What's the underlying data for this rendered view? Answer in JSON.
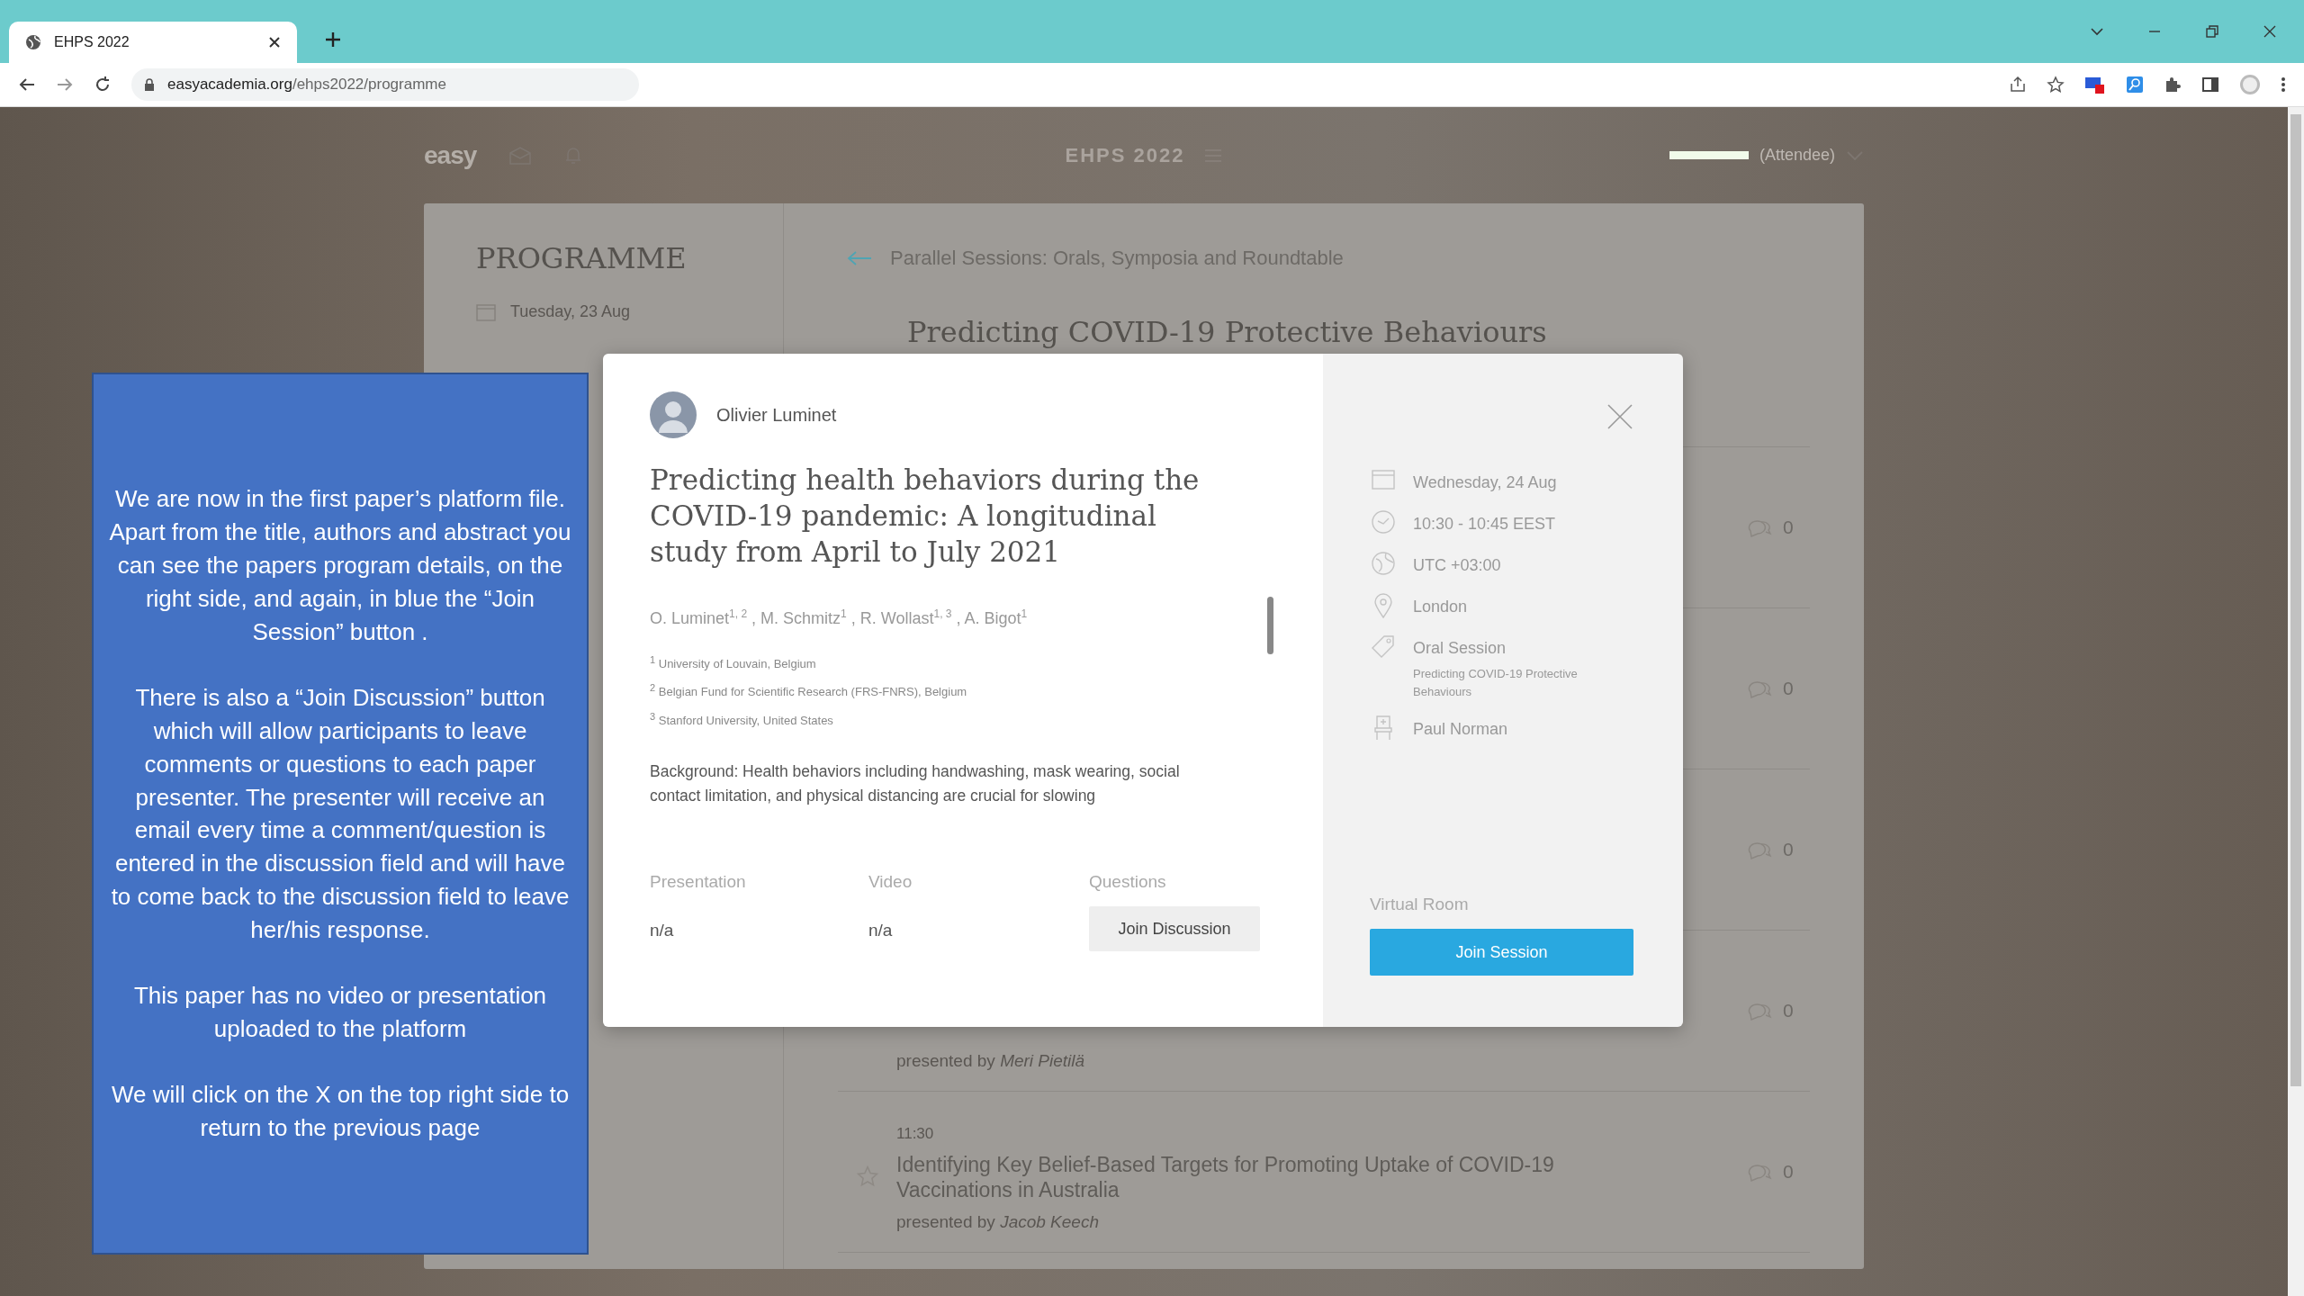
{
  "browser": {
    "tab": {
      "title": "EHPS 2022",
      "selected": true
    },
    "url_host": "easyacademia.org",
    "url_path": "/ehps2022/programme"
  },
  "header": {
    "logo": "easy",
    "event": "EHPS 2022",
    "role": "(Attendee)"
  },
  "programme": {
    "title": "PROGRAMME",
    "date": "Tuesday, 23 Aug"
  },
  "session": {
    "breadcrumb": "Parallel Sessions: Orals, Symposia and Roundtable",
    "title": "Predicting COVID-19 Protective Behaviours",
    "talks": [
      {
        "comments": "0"
      },
      {
        "comments": "0"
      },
      {
        "comments": "0"
      },
      {
        "presenter_prefix": "presented by",
        "presenter": "Meri Pietilä",
        "comments": "0"
      },
      {
        "time": "11:30",
        "starred": false,
        "title": "Identifying Key Belief-Based Targets for Promoting Uptake of COVID-19 Vaccinations in Australia",
        "presenter_prefix": "presented by",
        "presenter": "Jacob Keech",
        "comments": "0"
      }
    ]
  },
  "modal": {
    "presenter": "Olivier Luminet",
    "title": "Predicting health behaviors during the COVID-19 pandemic: A longitudinal study from April to July 2021",
    "authors": "O. Luminet$^{1, 2}$ , M. Schmitz$^{1}$ , R. Wollast$^{1, 3}$ , A. Bigot$^{1}$",
    "affiliations": [
      {
        "mark": "1",
        "text": "University of Louvain, Belgium"
      },
      {
        "mark": "2",
        "text": "Belgian Fund for Scientific Research (FRS-FNRS), Belgium"
      },
      {
        "mark": "3",
        "text": "Stanford University, United States"
      }
    ],
    "abstract": "Background: Health behaviors including handwashing, mask wearing, social contact limitation, and physical distancing are crucial for slowing",
    "footer": [
      {
        "label": "Presentation",
        "kind": "text",
        "value": "n/a"
      },
      {
        "label": "Video",
        "kind": "text",
        "value": "n/a"
      },
      {
        "label": "Questions",
        "kind": "button",
        "value": "Join Discussion"
      }
    ],
    "details": [
      {
        "kind": "date",
        "text": "Wednesday, 24 Aug"
      },
      {
        "kind": "time",
        "text": "10:30 - 10:45 EEST"
      },
      {
        "kind": "timezone",
        "text": "UTC +03:00"
      },
      {
        "kind": "location",
        "text": "London"
      },
      {
        "kind": "session",
        "text": "Oral Session",
        "detail": "Predicting COVID-19 Protective Behaviours"
      },
      {
        "kind": "chair",
        "text": "Paul Norman"
      }
    ],
    "room_label": "Virtual Room",
    "room_button": "Join Session"
  },
  "annotation": {
    "paragraphs": [
      "We are now in the first paper’s platform file. Apart from the title, authors and abstract you can see the papers program details, on the right side, and again, in blue the “Join Session” button .",
      "There is also a “Join Discussion” button which will allow participants to leave comments or questions to each paper presenter. The presenter will receive an email every time a comment/question is entered in the discussion field and will have to come back to the discussion field to leave her/his response.",
      "This paper has no video or presentation uploaded to the platform",
      "We will click on the X on the top right side to return to the previous page"
    ]
  }
}
